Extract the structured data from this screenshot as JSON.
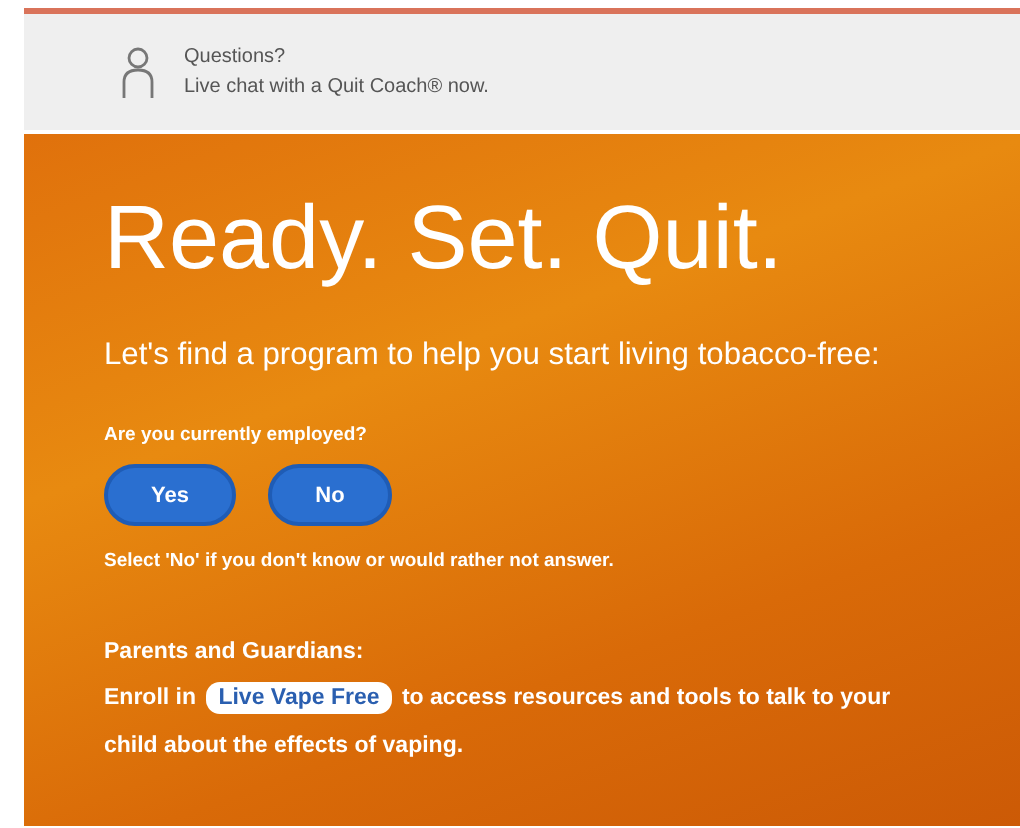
{
  "help_bar": {
    "title": "Questions?",
    "subtitle": "Live chat with a Quit Coach® now."
  },
  "hero": {
    "title": "Ready. Set. Quit.",
    "subtitle": "Let's find a program to help you start living tobacco-free:"
  },
  "question": {
    "label": "Are you currently employed?",
    "options": [
      {
        "label": "Yes",
        "selected": false
      },
      {
        "label": "No",
        "selected": false
      }
    ],
    "note": "Select 'No' if you don't know or would rather not answer."
  },
  "parents": {
    "heading": "Parents and Guardians:",
    "before": "Enroll in",
    "link": "Live Vape Free",
    "after": "to access resources and tools to talk to your child about the effects of vaping."
  }
}
